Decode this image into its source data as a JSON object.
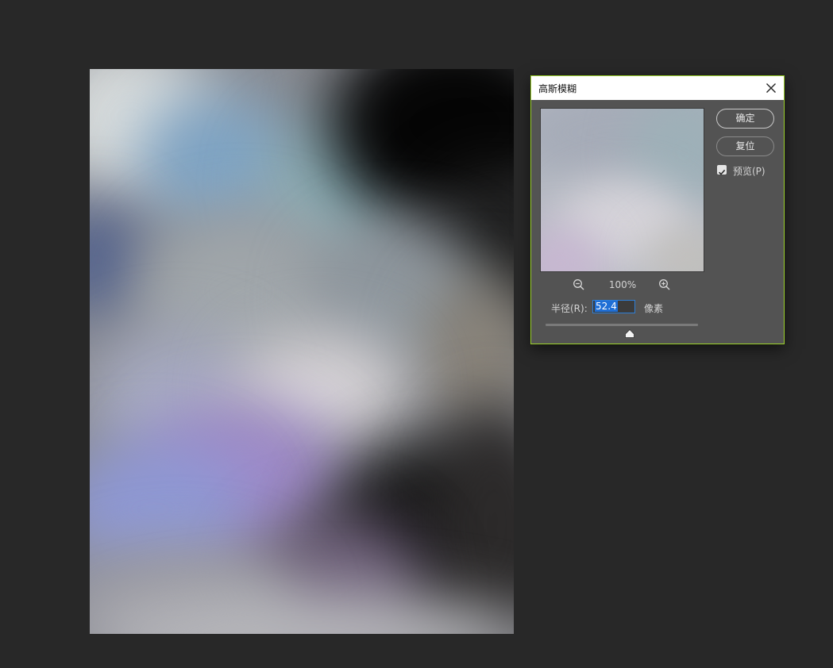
{
  "dialog": {
    "title": "高斯模糊",
    "ok_label": "确定",
    "reset_label": "复位",
    "preview_label": "预览(P)",
    "preview_checked": true,
    "zoom_level": "100%",
    "radius_label": "半径(R):",
    "radius_value": "52.4",
    "unit_label": "像素",
    "accent_color": "#9bd12a"
  },
  "icons": {
    "close": "close-icon",
    "zoom_out": "zoom-out-icon",
    "zoom_in": "zoom-in-icon",
    "check": "checkmark-icon",
    "slider": "slider-thumb-icon"
  }
}
